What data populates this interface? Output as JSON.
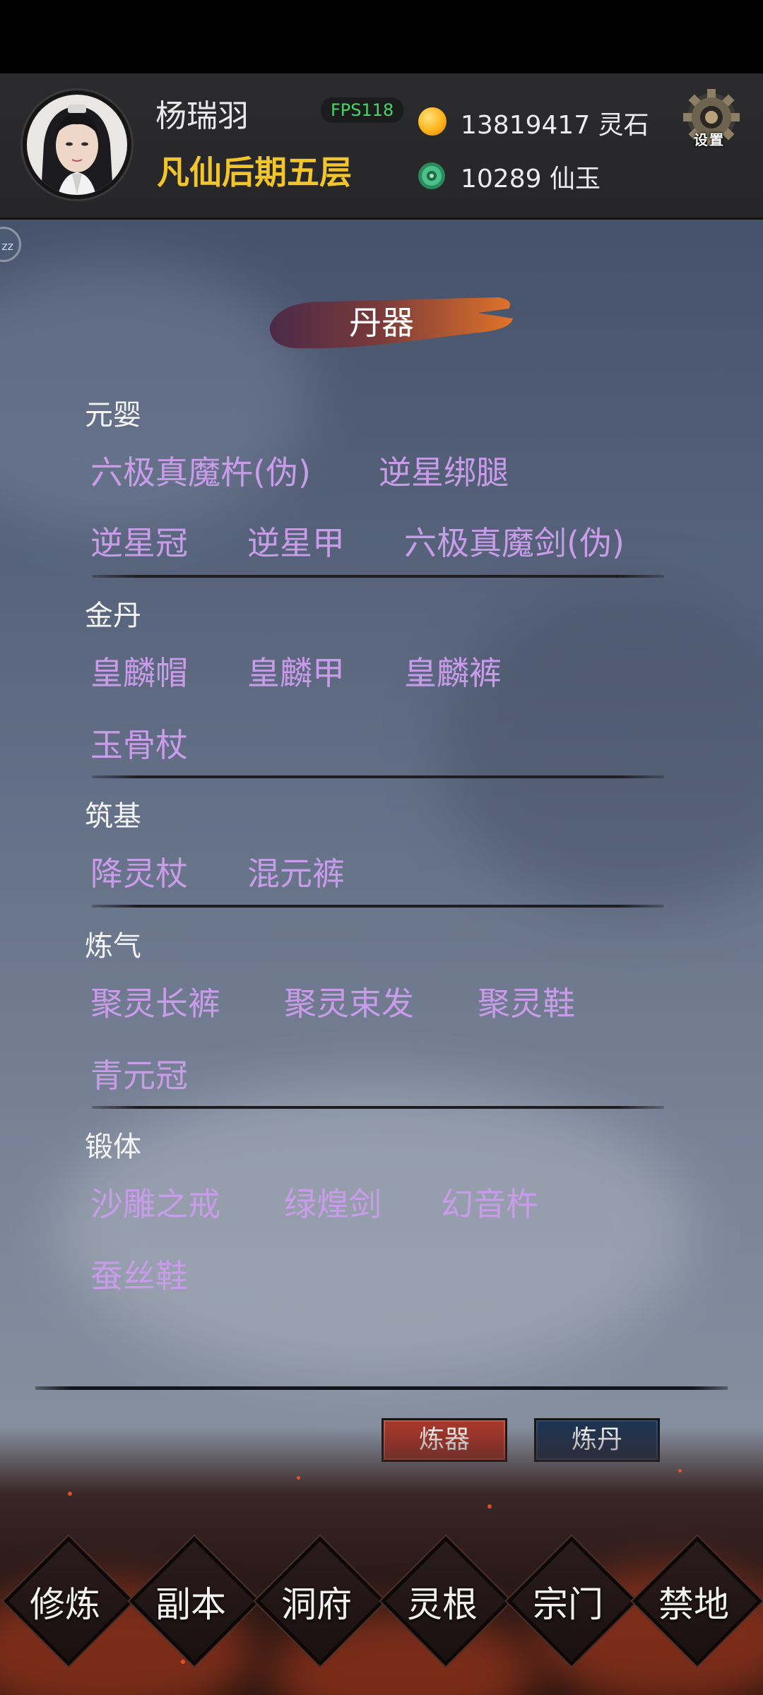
{
  "header": {
    "player_name": "杨瑞羽",
    "realm": "凡仙后期五层",
    "fps": "FPS118",
    "currency_1_text": "13819417 灵石",
    "currency_2_text": "10289 仙玉",
    "settings_label": "设置",
    "icons": {
      "coin": "spirit-stone-icon",
      "jade": "jade-icon",
      "settings": "gear-icon"
    }
  },
  "panel": {
    "title": "丹器",
    "categories": [
      {
        "label": "元婴",
        "items": [
          "六极真魔杵(伪)",
          "逆星绑腿",
          "逆星冠",
          "逆星甲",
          "六极真魔剑(伪)"
        ]
      },
      {
        "label": "金丹",
        "items": [
          "皇麟帽",
          "皇麟甲",
          "皇麟裤",
          "玉骨杖"
        ]
      },
      {
        "label": "筑基",
        "items": [
          "降灵杖",
          "混元裤"
        ]
      },
      {
        "label": "炼气",
        "items": [
          "聚灵长裤",
          "聚灵束发",
          "聚灵鞋",
          "青元冠"
        ]
      },
      {
        "label": "锻体",
        "items": [
          "沙雕之戒",
          "绿煌剑",
          "幻音杵",
          "蚕丝鞋"
        ]
      }
    ],
    "side_badge": "zz"
  },
  "actions": {
    "forge": "炼器",
    "alchemy": "炼丹"
  },
  "nav": [
    "修炼",
    "副本",
    "洞府",
    "灵根",
    "宗门",
    "禁地"
  ],
  "colors": {
    "item": "#c89ce8",
    "realm": "#f2c52a",
    "fps": "#48d46a",
    "forge_btn": "#a4372b",
    "alchemy_btn": "#1f3450"
  }
}
